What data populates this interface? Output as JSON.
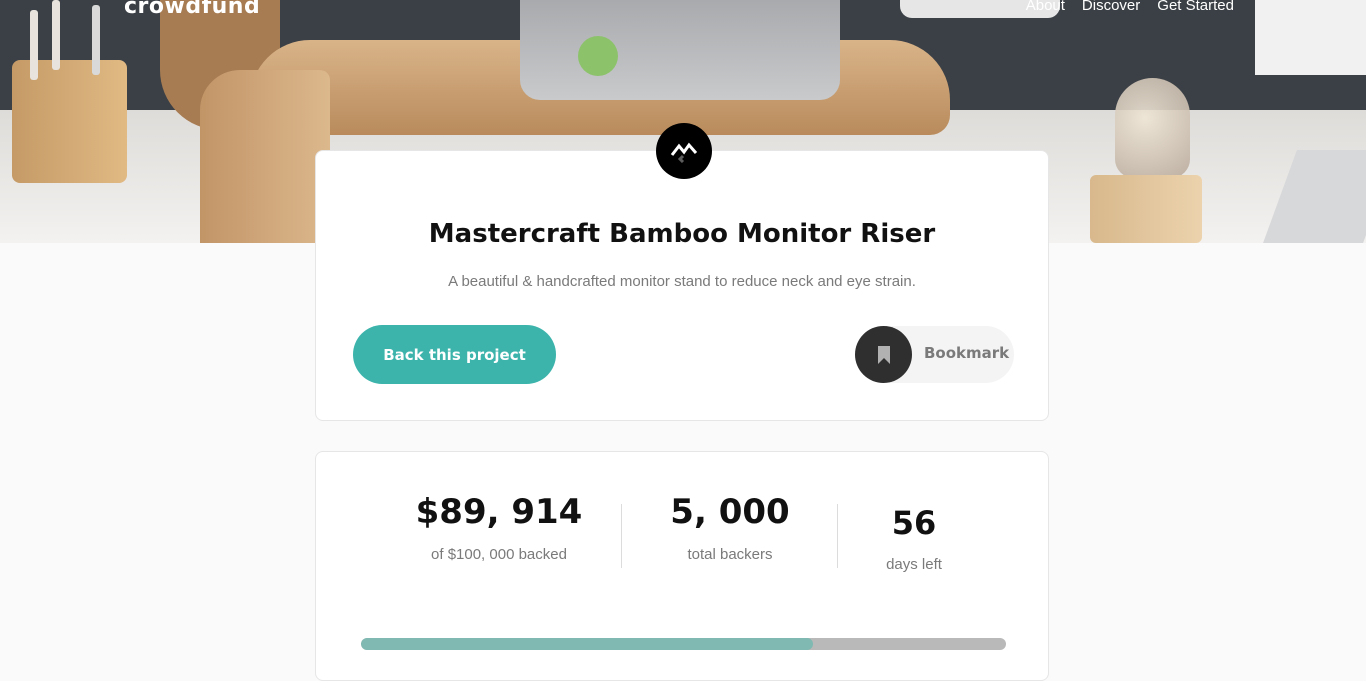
{
  "header": {
    "logo": "crowdfund",
    "nav": [
      {
        "label": "About"
      },
      {
        "label": "Discover"
      },
      {
        "label": "Get Started"
      }
    ]
  },
  "project": {
    "title": "Mastercraft Bamboo Monitor Riser",
    "description": "A beautiful & handcrafted monitor stand to reduce neck and eye strain.",
    "back_label": "Back this project",
    "bookmark_label": "Bookmark"
  },
  "stats": {
    "backed_amount": "$89, 914",
    "backed_label": "of $100, 000 backed",
    "backers": "5, 000",
    "backers_label": "total backers",
    "days": "56",
    "days_label": "days left",
    "progress_fraction": 0.7
  },
  "colors": {
    "accent": "#3cb4ac",
    "progress_fill": "#7fb9b2",
    "progress_track": "#b9b9b9",
    "dark": "#2f2f2f"
  },
  "icons": {
    "brand": "mastercraft-logo-icon",
    "bookmark": "bookmark-icon"
  }
}
